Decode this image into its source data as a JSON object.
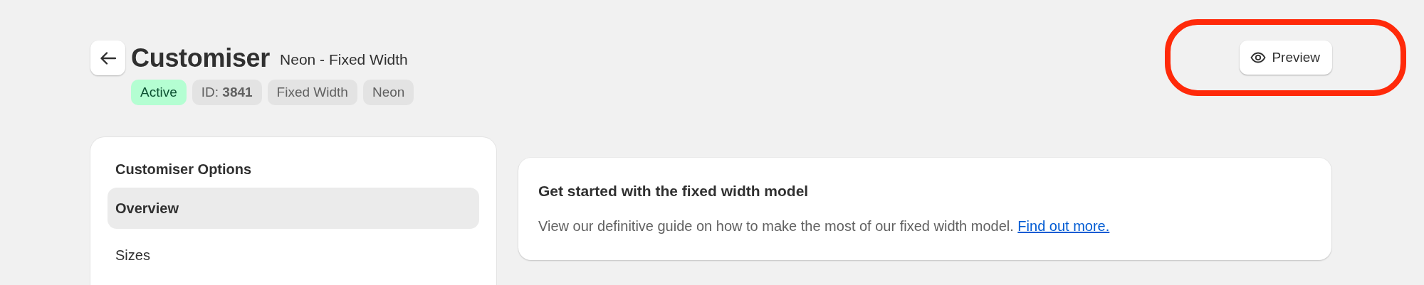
{
  "header": {
    "title": "Customiser",
    "subtitle": "Neon - Fixed Width",
    "tags": [
      {
        "label": "Active",
        "kind": "success"
      },
      {
        "label": "ID: **3841**",
        "kind": "neutral"
      },
      {
        "label": "Fixed Width",
        "kind": "neutral"
      },
      {
        "label": "Neon",
        "kind": "neutral"
      }
    ],
    "actions": [
      {
        "label": "Preview",
        "highlighted": true
      }
    ]
  },
  "sidebar": {
    "title": "Customiser Options",
    "items": [
      {
        "label": "Overview",
        "selected": true
      },
      {
        "label": "Sizes",
        "selected": false
      }
    ]
  },
  "card": {
    "title": "Get started with the fixed width model",
    "body": "View our definitive guide on how to make the most of our fixed width model.",
    "link": "Find out more."
  }
}
